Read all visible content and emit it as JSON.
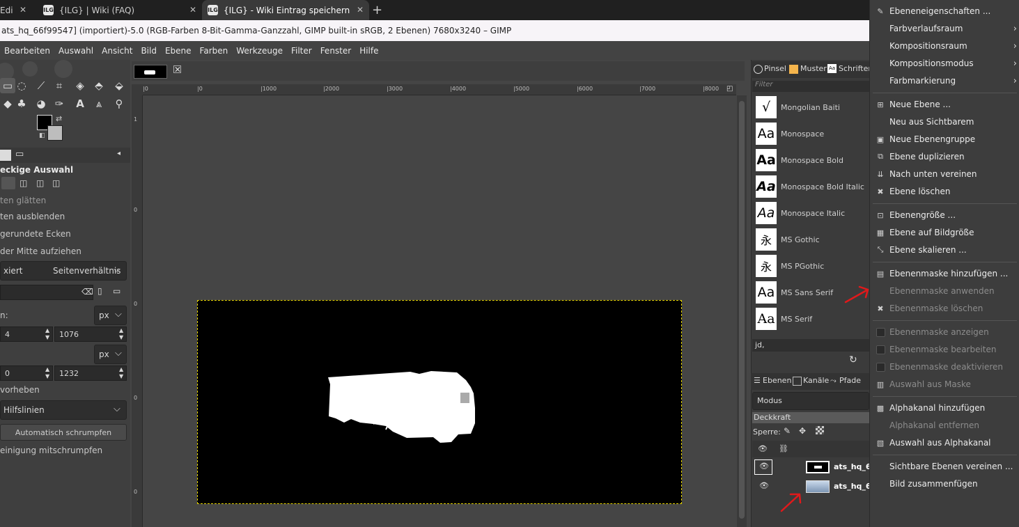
{
  "browser": {
    "tabs": [
      {
        "label": "Edi",
        "active": false
      },
      {
        "label": "{ILG} | Wiki (FAQ)",
        "active": false
      },
      {
        "label": "{ILG} - Wiki Eintrag speichern",
        "active": true
      }
    ],
    "new_tab": "+",
    "favicon_text": "ILG"
  },
  "window": {
    "title": "ats_hq_66f99547] (importiert)-5.0 (RGB-Farben 8-Bit-Gamma-Ganzzahl, GIMP built-in sRGB, 2 Ebenen) 7680x3240 – GIMP"
  },
  "menubar": [
    "Bearbeiten",
    "Auswahl",
    "Ansicht",
    "Bild",
    "Ebene",
    "Farben",
    "Werkzeuge",
    "Filter",
    "Fenster",
    "Hilfe"
  ],
  "tool_options": {
    "title": "eckige Auswahl",
    "opt_antialias": "ten glätten",
    "opt_feather": "ten ausblenden",
    "opt_rounded": "gerundete Ecken",
    "opt_center": "der Mitte aufziehen",
    "fixed_label": "xiert",
    "fixed_value": "Seitenverhältnis",
    "pos_label": "n:",
    "pos_unit": "px",
    "pos_x": "4",
    "pos_y": "1076",
    "size_unit": "px",
    "size_w": "0",
    "size_h": "1232",
    "highlight": "vorheben",
    "guides_value": "Hilfslinien",
    "shrink_button": "Automatisch schrumpfen",
    "merged": "einigung mitschrumpfen"
  },
  "ruler": {
    "top": [
      "|0",
      "|0",
      "|1000",
      "|2000",
      "|3000",
      "|4000",
      "|5000",
      "|6000",
      "|7000",
      "|8000"
    ],
    "left": [
      "1",
      "0",
      "0",
      "0",
      "0"
    ]
  },
  "dock": {
    "tabs": [
      "Pinsel",
      "Muster",
      "Schriften"
    ],
    "filter_placeholder": "Filter",
    "fonts": [
      {
        "preview": "√",
        "name": "Mongolian Baiti"
      },
      {
        "preview": "Aa",
        "name": "Monospace"
      },
      {
        "preview": "Aa",
        "name": "Monospace Bold"
      },
      {
        "preview": "Aa",
        "name": "Monospace Bold Italic"
      },
      {
        "preview": "Aa",
        "name": "Monospace Italic"
      },
      {
        "preview": "永",
        "name": "MS Gothic"
      },
      {
        "preview": "永",
        "name": "MS PGothic"
      },
      {
        "preview": "Aa",
        "name": "MS Sans Serif"
      },
      {
        "preview": "Aa",
        "name": "MS Serif"
      }
    ],
    "font_input": "jd,",
    "layer_tabs": [
      "Ebenen",
      "Kanäle",
      "Pfade"
    ],
    "mode_label": "Modus",
    "opacity_label": "Deckkraft",
    "lock_label": "Sperre:",
    "layers": [
      {
        "name": "ats_hq_6"
      },
      {
        "name": "ats_hq_6"
      }
    ]
  },
  "context_menu": [
    {
      "icon": "properties-icon",
      "glyph": "✎",
      "label": "Ebeneneigenschaften ...",
      "disabled": false,
      "sub": false
    },
    {
      "icon": "",
      "glyph": "",
      "label": "Farbverlaufsraum",
      "disabled": false,
      "sub": true
    },
    {
      "icon": "",
      "glyph": "",
      "label": "Kompositionsraum",
      "disabled": false,
      "sub": true
    },
    {
      "icon": "",
      "glyph": "",
      "label": "Kompositionsmodus",
      "disabled": false,
      "sub": true
    },
    {
      "icon": "",
      "glyph": "",
      "label": "Farbmarkierung",
      "disabled": false,
      "sub": true
    },
    {
      "sep": true
    },
    {
      "icon": "new-layer-icon",
      "glyph": "⊞",
      "label": "Neue Ebene ...",
      "disabled": false,
      "sub": false
    },
    {
      "icon": "",
      "glyph": "",
      "label": "Neu aus Sichtbarem",
      "disabled": false,
      "sub": false
    },
    {
      "icon": "layer-group-icon",
      "glyph": "▣",
      "label": "Neue Ebenengruppe",
      "disabled": false,
      "sub": false
    },
    {
      "icon": "duplicate-icon",
      "glyph": "⧉",
      "label": "Ebene duplizieren",
      "disabled": false,
      "sub": false
    },
    {
      "icon": "merge-down-icon",
      "glyph": "⇊",
      "label": "Nach unten vereinen",
      "disabled": false,
      "sub": false
    },
    {
      "icon": "delete-icon",
      "glyph": "✖",
      "label": "Ebene löschen",
      "disabled": false,
      "sub": false
    },
    {
      "sep": true
    },
    {
      "icon": "layer-size-icon",
      "glyph": "⊡",
      "label": "Ebenengröße ...",
      "disabled": false,
      "sub": false
    },
    {
      "icon": "layer-to-image-icon",
      "glyph": "▦",
      "label": "Ebene auf Bildgröße",
      "disabled": false,
      "sub": false
    },
    {
      "icon": "scale-icon",
      "glyph": "⤡",
      "label": "Ebene skalieren ...",
      "disabled": false,
      "sub": false
    },
    {
      "sep": true
    },
    {
      "icon": "add-mask-icon",
      "glyph": "▤",
      "label": "Ebenenmaske hinzufügen ...",
      "disabled": false,
      "sub": false
    },
    {
      "icon": "",
      "glyph": "",
      "label": "Ebenenmaske anwenden",
      "disabled": true,
      "sub": false
    },
    {
      "icon": "delete-mask-icon",
      "glyph": "✖",
      "label": "Ebenenmaske löschen",
      "disabled": true,
      "sub": false
    },
    {
      "sep": true
    },
    {
      "icon": "checkbox-icon",
      "glyph": "check",
      "label": "Ebenenmaske anzeigen",
      "disabled": true,
      "sub": false
    },
    {
      "icon": "checkbox-icon",
      "glyph": "check",
      "label": "Ebenenmaske bearbeiten",
      "disabled": true,
      "sub": false
    },
    {
      "icon": "checkbox-icon",
      "glyph": "check",
      "label": "Ebenenmaske deaktivieren",
      "disabled": true,
      "sub": false
    },
    {
      "icon": "mask-selection-icon",
      "glyph": "▥",
      "label": "Auswahl aus Maske",
      "disabled": true,
      "sub": false
    },
    {
      "sep": true
    },
    {
      "icon": "alpha-icon",
      "glyph": "▩",
      "label": "Alphakanal hinzufügen",
      "disabled": false,
      "sub": false
    },
    {
      "icon": "",
      "glyph": "",
      "label": "Alphakanal entfernen",
      "disabled": true,
      "sub": false
    },
    {
      "icon": "alpha-selection-icon",
      "glyph": "▧",
      "label": "Auswahl aus Alphakanal",
      "disabled": false,
      "sub": false
    },
    {
      "sep": true
    },
    {
      "icon": "",
      "glyph": "",
      "label": "Sichtbare Ebenen vereinen ...",
      "disabled": false,
      "sub": false
    },
    {
      "icon": "",
      "glyph": "",
      "label": "Bild zusammenfügen",
      "disabled": false,
      "sub": false
    }
  ],
  "colors": {
    "accent_arrow": "#e0191b",
    "selection": "#e5d300"
  }
}
